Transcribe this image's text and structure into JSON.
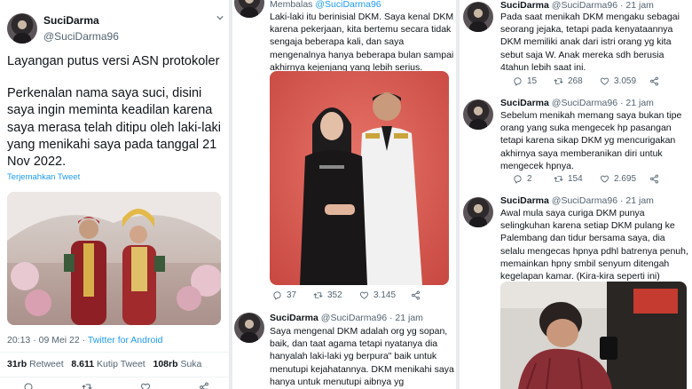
{
  "tweet_main": {
    "name": "SuciDarma",
    "handle": "@SuciDarma96",
    "title": "Layangan putus versi ASN protokoler",
    "body": "Perkenalan nama saya suci, disini saya ingin meminta keadilan karena saya merasa telah ditipu oleh laki-laki yang menikahi saya pada tanggal 21 Nov 2022.",
    "translate_label": "Terjemahkan Tweet",
    "timestamp": "20:13 · 09 Mei 22 · ",
    "source": "Twitter for Android",
    "retweets_count": "31rb",
    "retweets_label": "Retweet",
    "quotes_count": "8.611",
    "quotes_label": "Kutip Tweet",
    "likes_count": "108rb",
    "likes_label": "Suka"
  },
  "reply_photo_tweet": {
    "replying_prefix": "Membalas ",
    "replying_handle": "@SuciDarma96",
    "body": "Laki-laki itu berinisial DKM. Saya kenal DKM karena pekerjaan, kita bertemu secara tidak sengaja beberapa kali, dan saya mengenalnya hanya beberapa bulan sampai akhirnya kejenjang yang lebih serius.",
    "replies": "37",
    "retweets": "352",
    "likes": "3.145"
  },
  "tweet_sopan": {
    "name": "SuciDarma",
    "handle": "@SuciDarma96",
    "time": "· 21 jam",
    "body": "Saya mengenal DKM adalah org yg sopan, baik, dan taat agama tetapi nyatanya dia hanyalah laki-laki yg berpura\" baik untuk menutupi kejahatannya. DKM menikahi saya hanya untuk menutupi aibnya yg berselingkuh dengan istri orang."
  },
  "tweet_jejaka": {
    "name": "SuciDarma",
    "handle": "@SuciDarma96",
    "time": "· 21 jam",
    "body": "Pada saat menikah DKM mengaku sebagai seorang jejaka, tetapi pada kenyataannya DKM memiliki anak dari istri orang yg kita sebut saja W. Anak mereka sdh berusia 4tahun lebih saat ini.",
    "replies": "15",
    "retweets": "268",
    "likes": "3.059"
  },
  "tweet_hp": {
    "name": "SuciDarma",
    "handle": "@SuciDarma96",
    "time": "· 21 jam",
    "body": "Sebelum menikah memang saya bukan tipe orang yang suka mengecek hp pasangan tetapi karena sikap DKM yg mencurigakan akhirnya saya memberanikan diri untuk mengecek hpnya.",
    "replies": "2",
    "retweets": "154",
    "likes": "2.695"
  },
  "tweet_curiga": {
    "name": "SuciDarma",
    "handle": "@SuciDarma96",
    "time": "· 21 jam",
    "body": "Awal mula saya curiga DKM punya selingkuhan karena setiap DKM pulang ke Palembang dan tidur bersama saya, dia selalu mengecas hpnya pdhl batrenya penuh, memainkan hpny smbil senyum ditengah kegelapan kamar. (Kira-kira seperti ini)"
  },
  "colors": {
    "text": "#0f1419",
    "muted": "#536471",
    "link": "#1d9bf0",
    "divider": "#e9ecef"
  }
}
